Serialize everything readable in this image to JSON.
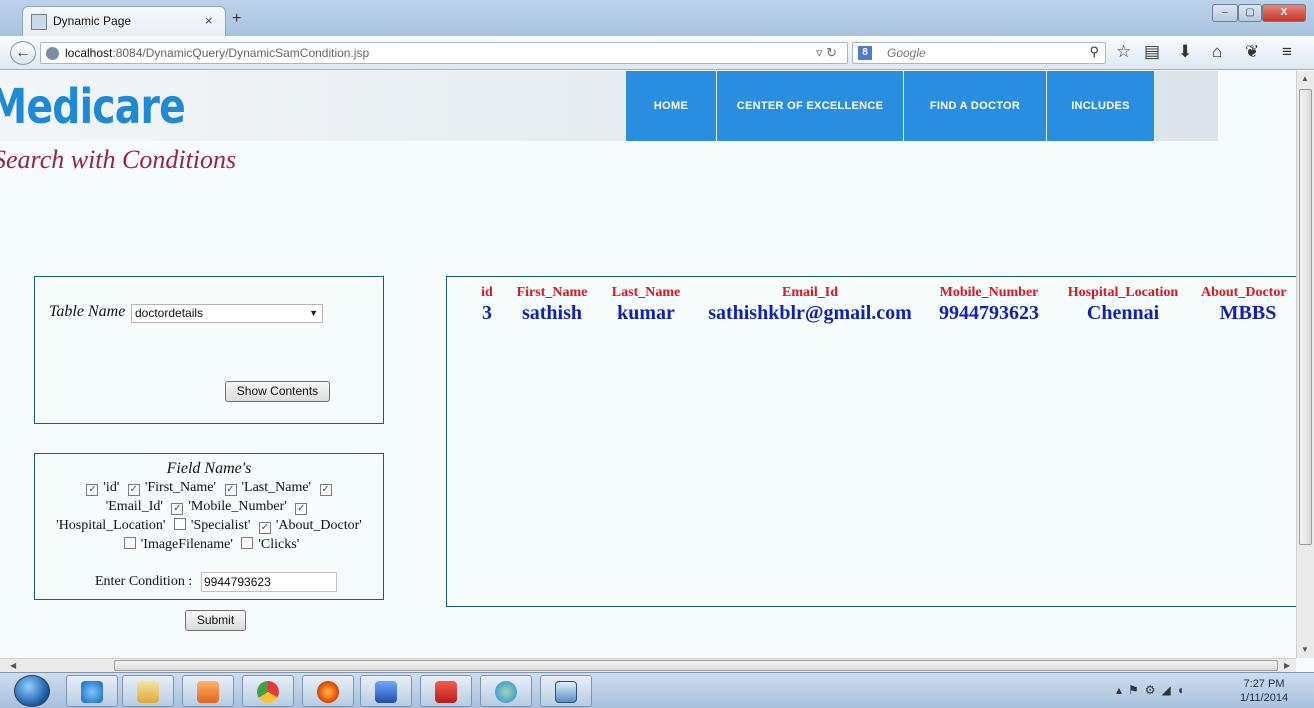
{
  "browser": {
    "tab_title": "Dynamic Page",
    "tab_close": "×",
    "new_tab": "+",
    "url_host": "localhost",
    "url_rest": ":8084/DynamicQuery/DynamicSamCondition.jsp",
    "search_placeholder": "Google",
    "search_engine_badge": "8",
    "window_controls": [
      "–",
      "▢",
      "X"
    ]
  },
  "site": {
    "logo": "Medicare",
    "heading": "Search with Conditions",
    "menu": [
      {
        "label": "HOME"
      },
      {
        "label": "CENTER OF EXCELLENCE"
      },
      {
        "label": "FIND A DOCTOR"
      },
      {
        "label": "INCLUDES"
      }
    ]
  },
  "table_panel": {
    "label": "Table Name",
    "selected_table": "doctordetails",
    "show_button": "Show Contents"
  },
  "fields_panel": {
    "title": "Field Name's",
    "fields": [
      {
        "name": "'id'",
        "checked": true
      },
      {
        "name": "'First_Name'",
        "checked": true
      },
      {
        "name": "'Last_Name'",
        "checked": true
      },
      {
        "name": "'Email_Id'",
        "checked": true
      },
      {
        "name": "'Mobile_Number'",
        "checked": true
      },
      {
        "name": "'Hospital_Location'",
        "checked": true
      },
      {
        "name": "'Specialist'",
        "checked": false
      },
      {
        "name": "'About_Doctor'",
        "checked": true
      },
      {
        "name": "'ImageFilename'",
        "checked": false
      },
      {
        "name": "'Clicks'",
        "checked": false
      }
    ],
    "condition_label": "Enter Condition :",
    "condition_value": "9944793623",
    "submit_button": "Submit"
  },
  "results": {
    "headers": [
      "id",
      "First_Name",
      "Last_Name",
      "Email_Id",
      "Mobile_Number",
      "Hospital_Location",
      "About_Doctor"
    ],
    "rows": [
      [
        "3",
        "sathish",
        "kumar",
        "sathishkblr@gmail.com",
        "9944793623",
        "Chennai",
        "MBBS"
      ]
    ]
  },
  "taskbar": {
    "time": "7:27 PM",
    "date": "1/11/2014"
  }
}
